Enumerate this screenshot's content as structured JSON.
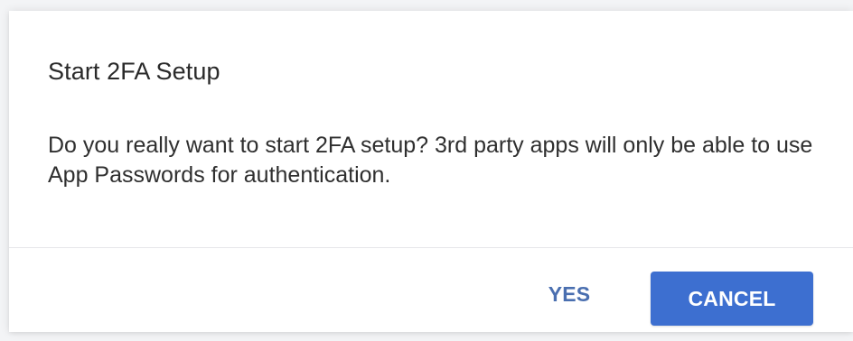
{
  "dialog": {
    "title": "Start 2FA Setup",
    "message": "Do you really want to start 2FA setup? 3rd party apps will only be able to use App Passwords for authentication.",
    "buttons": {
      "yes_label": "YES",
      "cancel_label": "CANCEL"
    }
  },
  "colors": {
    "primary": "#3d6fd0",
    "text_button": "#4a6fb0",
    "title_text": "#2a2a2a",
    "body_text": "#2f2f2f"
  }
}
